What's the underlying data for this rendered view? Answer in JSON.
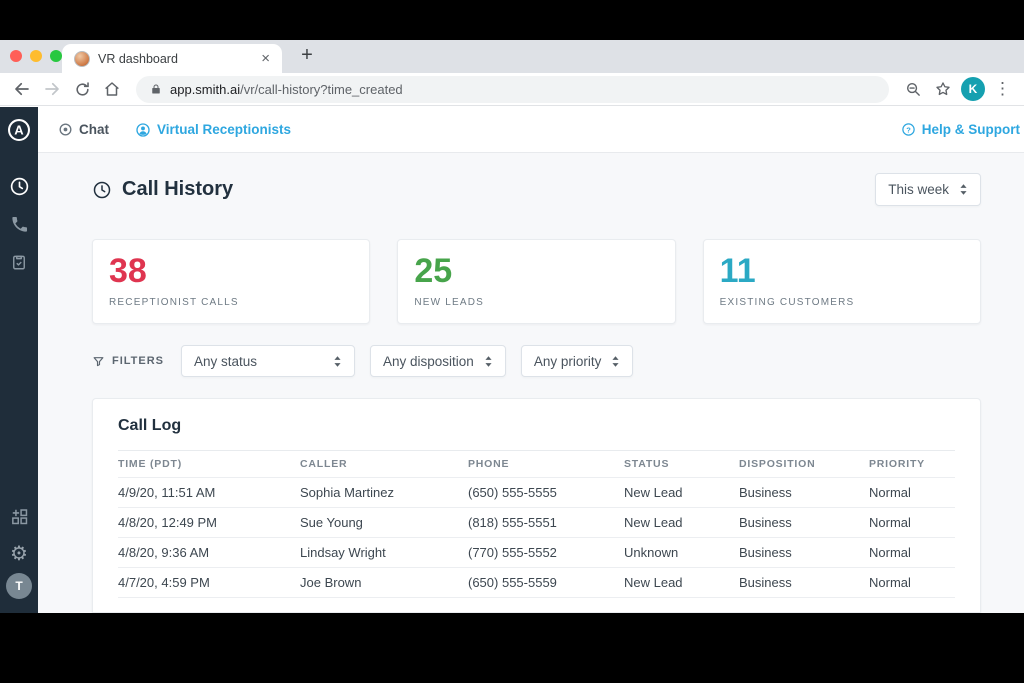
{
  "browser": {
    "tab_title": "VR dashboard",
    "url_host": "app.smith.ai",
    "url_path": "/vr/call-history?time_created",
    "profile_initial": "K",
    "new_tab_label": "+",
    "close_tab_label": "×",
    "menu_glyph": "⋮"
  },
  "topnav": {
    "chat_label": "Chat",
    "vr_label": "Virtual Receptionists",
    "help_label": "Help & Support"
  },
  "page": {
    "title": "Call History",
    "range_value": "This week"
  },
  "stats": [
    {
      "value": "38",
      "label": "RECEPTIONIST CALLS",
      "color": "#df3550"
    },
    {
      "value": "25",
      "label": "NEW LEADS",
      "color": "#47a44b"
    },
    {
      "value": "11",
      "label": "EXISTING CUSTOMERS",
      "color": "#2ba9c4"
    }
  ],
  "filters": {
    "label": "FILTERS",
    "status_value": "Any status",
    "disposition_value": "Any disposition",
    "priority_value": "Any priority"
  },
  "call_log": {
    "title": "Call Log",
    "columns": [
      "TIME (PDT)",
      "CALLER",
      "PHONE",
      "STATUS",
      "DISPOSITION",
      "PRIORITY"
    ],
    "rows": [
      [
        "4/9/20, 11:51 AM",
        "Sophia Martinez",
        "(650) 555-5555",
        "New Lead",
        "Business",
        "Normal"
      ],
      [
        "4/8/20, 12:49 PM",
        "Sue Young",
        "(818) 555-5551",
        "New Lead",
        "Business",
        "Normal"
      ],
      [
        "4/8/20, 9:36 AM",
        "Lindsay Wright",
        "(770) 555-5552",
        "Unknown",
        "Business",
        "Normal"
      ],
      [
        "4/7/20, 4:59 PM",
        "Joe Brown",
        "(650) 555-5559",
        "New Lead",
        "Business",
        "Normal"
      ]
    ]
  },
  "sidebar": {
    "user_initial": "T",
    "gear_glyph": "⚙"
  },
  "colors": {
    "brand_blue": "#2ea7e0",
    "sidebar_bg": "#1f2d3a"
  }
}
